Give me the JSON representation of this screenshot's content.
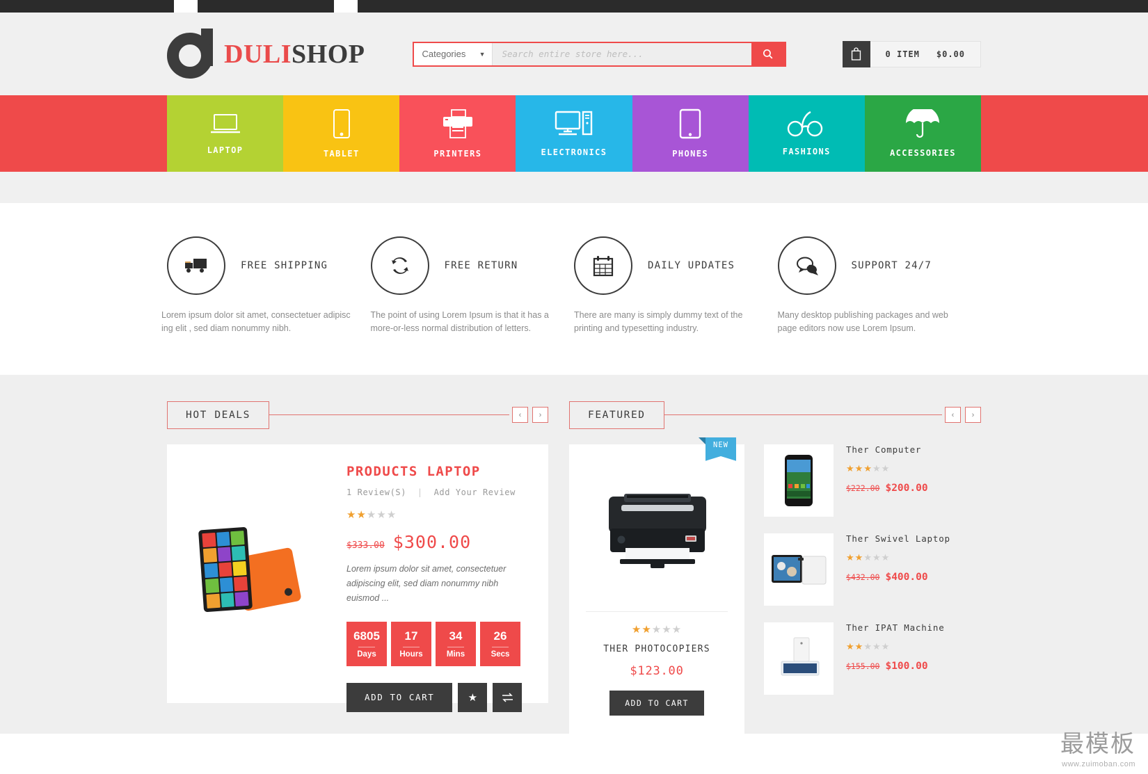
{
  "brand": {
    "name_red": "DULI",
    "name_dark": "SHOP"
  },
  "search": {
    "category_label": "Categories",
    "placeholder": "Search entire store here...",
    "value": "",
    "button_icon": "search-icon"
  },
  "cart": {
    "icon": "bag-icon",
    "items_label": "0  ITEM",
    "total": "$0.00"
  },
  "categories": [
    {
      "label": "LAPTOP",
      "icon": "laptop-icon",
      "color": "#b4d233"
    },
    {
      "label": "TABLET",
      "icon": "tablet-icon",
      "color": "#f9c313"
    },
    {
      "label": "PRINTERS",
      "icon": "printer-icon",
      "color": "#f9515a"
    },
    {
      "label": "ELECTRONICS",
      "icon": "desktop-icon",
      "color": "#27b7e8"
    },
    {
      "label": "PHONES",
      "icon": "phone-icon",
      "color": "#a855d6"
    },
    {
      "label": "FASHIONS",
      "icon": "glasses-icon",
      "color": "#00bcb4"
    },
    {
      "label": "ACCESSORIES",
      "icon": "umbrella-icon",
      "color": "#2ba745"
    }
  ],
  "services": [
    {
      "icon": "truck-icon",
      "title": "FREE SHIPPING",
      "desc": "Lorem ipsum dolor sit amet, consectetuer adipisc ing elit , sed diam nonummy nibh."
    },
    {
      "icon": "refresh-icon",
      "title": "FREE RETURN",
      "desc": "The point of using Lorem Ipsum is that it has a more-or-less normal distribution of letters."
    },
    {
      "icon": "calendar-icon",
      "title": "DAILY UPDATES",
      "desc": "There are many is simply dummy text of the printing and typesetting industry."
    },
    {
      "icon": "chat-icon",
      "title": "SUPPORT 24/7",
      "desc": "Many desktop publishing packages and web page editors now use Lorem Ipsum."
    }
  ],
  "hot_deals": {
    "section_title": "HOT DEALS",
    "prev_icon": "chevron-left-icon",
    "next_icon": "chevron-right-icon",
    "product": {
      "name": "PRODUCTS LAPTOP",
      "reviews_count": "1 Review(S)",
      "add_review": "Add Your Review",
      "rating": 2.5,
      "old_price": "$333.00",
      "price": "$300.00",
      "description": "Lorem ipsum dolor sit amet, consectetuer adipiscing elit, sed diam nonummy nibh euismod ...",
      "countdown": [
        {
          "value": "6805",
          "label": "Days"
        },
        {
          "value": "17",
          "label": "Hours"
        },
        {
          "value": "34",
          "label": "Mins"
        },
        {
          "value": "26",
          "label": "Secs"
        }
      ],
      "add_to_cart": "ADD TO CART",
      "wishlist_icon": "star-icon",
      "compare_icon": "compare-icon"
    }
  },
  "featured": {
    "section_title": "FEATURED",
    "prev_icon": "chevron-left-icon",
    "next_icon": "chevron-right-icon",
    "main_product": {
      "badge": "NEW",
      "image": "printer-photo",
      "rating": 1.5,
      "name": "THER PHOTOCOPIERS",
      "price": "$123.00",
      "add_to_cart": "ADD TO CART"
    },
    "side_products": [
      {
        "name": "Ther Computer",
        "image": "smartphone-photo",
        "rating": 2.5,
        "old_price": "$222.00",
        "price": "$200.00"
      },
      {
        "name": "Ther Swivel Laptop",
        "image": "swivel-laptop-photo",
        "rating": 2.5,
        "old_price": "$432.00",
        "price": "$400.00"
      },
      {
        "name": "Ther IPAT Machine",
        "image": "tablet-photo",
        "rating": 2.5,
        "old_price": "$155.00",
        "price": "$100.00"
      }
    ]
  },
  "watermark": {
    "cn": "最模板",
    "url": "www.zuimoban.com"
  },
  "colors": {
    "accent": "#ef4a4a",
    "dark": "#3c3c3c",
    "star": "#f0a030"
  }
}
